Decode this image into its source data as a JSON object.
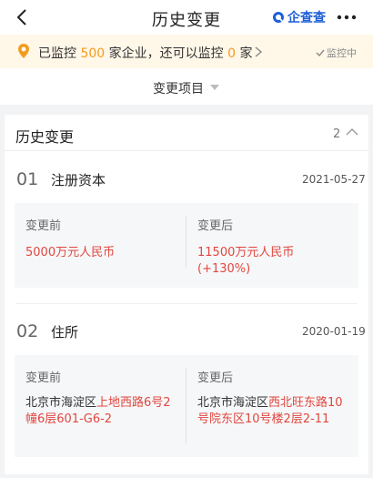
{
  "nav": {
    "title": "历史变更",
    "brand": "企查查"
  },
  "monitor": {
    "prefix": "已监控 ",
    "monitored_count": "500",
    "middle": " 家企业，还可以监控 ",
    "remaining_count": "0",
    "suffix": " 家",
    "status": "监控中"
  },
  "filter": {
    "label": "变更项目"
  },
  "history": {
    "title": "历史变更",
    "count": "2",
    "items": [
      {
        "index": "01",
        "name": "注册资本",
        "date": "2021-05-27",
        "before_label": "变更前",
        "after_label": "变更后",
        "before_value": "5000万元人民币",
        "after_value": "11500万元人民币",
        "after_note": "(+130%)"
      },
      {
        "index": "02",
        "name": "住所",
        "date": "2020-01-19",
        "before_label": "变更前",
        "after_label": "变更后",
        "before_plain": "北京市海淀区",
        "before_red": "上地西路6号2幢6层601-G6-2",
        "after_plain": "北京市海淀区",
        "after_red": "西北旺东路10号院东区10号楼2层2-11"
      }
    ]
  },
  "colors": {
    "accent_red": "#e0473e",
    "highlight_orange": "#f29c1f",
    "brand_blue": "#1e5fd6",
    "banner_bg": "#fff7e8"
  },
  "icons": {
    "back": "chevron-left-icon",
    "more": "more-dots-icon",
    "pin": "location-pin-icon",
    "collapse": "chevron-up-icon"
  }
}
